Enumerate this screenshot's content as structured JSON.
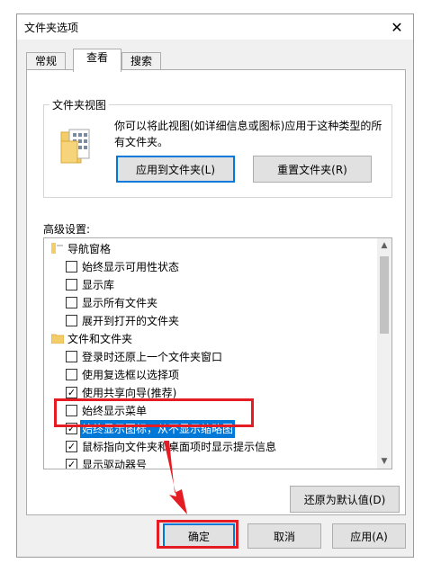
{
  "window": {
    "title": "文件夹选项"
  },
  "tabs": [
    {
      "label": "常规"
    },
    {
      "label": "查看"
    },
    {
      "label": "搜索"
    }
  ],
  "folder_views": {
    "group_title": "文件夹视图",
    "description": "你可以将此视图(如详细信息或图标)应用于这种类型的所有文件夹。",
    "apply_button": "应用到文件夹(L)",
    "reset_button": "重置文件夹(R)"
  },
  "advanced": {
    "label": "高级设置:",
    "items": [
      {
        "type": "category",
        "label": "导航窗格"
      },
      {
        "type": "checkbox",
        "label": "始终显示可用性状态",
        "checked": false
      },
      {
        "type": "checkbox",
        "label": "显示库",
        "checked": false
      },
      {
        "type": "checkbox",
        "label": "显示所有文件夹",
        "checked": false
      },
      {
        "type": "checkbox",
        "label": "展开到打开的文件夹",
        "checked": false
      },
      {
        "type": "category",
        "label": "文件和文件夹"
      },
      {
        "type": "checkbox",
        "label": "登录时还原上一个文件夹窗口",
        "checked": false
      },
      {
        "type": "checkbox",
        "label": "使用复选框以选择项",
        "checked": false
      },
      {
        "type": "checkbox",
        "label": "使用共享向导(推荐)",
        "checked": true
      },
      {
        "type": "checkbox",
        "label": "始终显示菜单",
        "checked": false
      },
      {
        "type": "checkbox",
        "label": "始终显示图标，从不显示缩略图",
        "checked": true,
        "selected": true
      },
      {
        "type": "checkbox",
        "label": "鼠标指向文件夹和桌面项时显示提示信息",
        "checked": true
      },
      {
        "type": "checkbox",
        "label": "显示驱动器号",
        "checked": true
      }
    ],
    "restore_defaults": "还原为默认值(D)"
  },
  "footer": {
    "ok": "确定",
    "cancel": "取消",
    "apply": "应用(A)"
  },
  "colors": {
    "accent": "#0078d7",
    "highlight": "#e51c23"
  }
}
